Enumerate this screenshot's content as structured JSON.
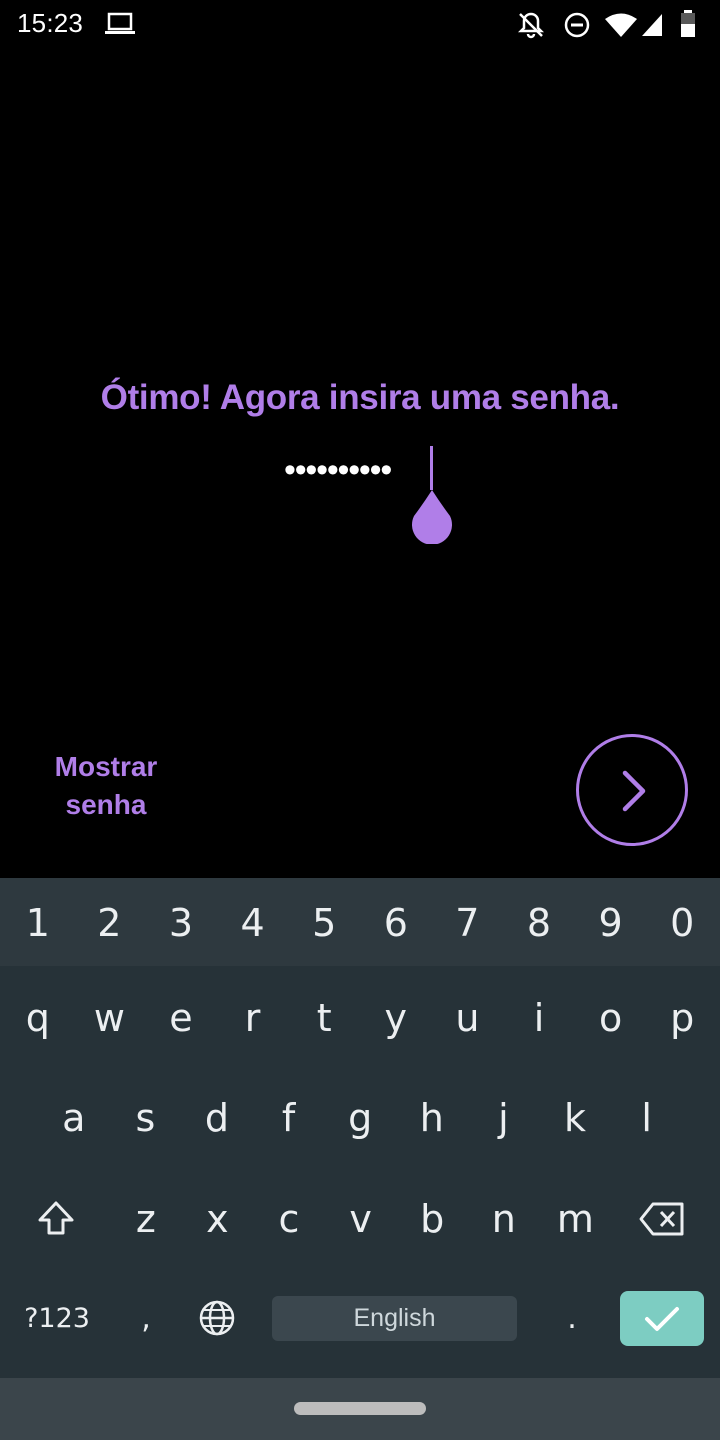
{
  "status_bar": {
    "time": "15:23",
    "icons": [
      "laptop-icon",
      "bell-off-icon",
      "dnd-icon",
      "wifi-icon",
      "signal-icon",
      "battery-icon"
    ]
  },
  "main": {
    "prompt": "Ótimo! Agora insira uma senha.",
    "password_masked": "••••••••••",
    "show_password_label": "Mostrar senha",
    "next_icon": "chevron-right-icon"
  },
  "keyboard": {
    "number_row": [
      "1",
      "2",
      "3",
      "4",
      "5",
      "6",
      "7",
      "8",
      "9",
      "0"
    ],
    "row1": [
      "q",
      "w",
      "e",
      "r",
      "t",
      "y",
      "u",
      "i",
      "o",
      "p"
    ],
    "row2": [
      "a",
      "s",
      "d",
      "f",
      "g",
      "h",
      "j",
      "k",
      "l"
    ],
    "row3": [
      "z",
      "x",
      "c",
      "v",
      "b",
      "n",
      "m"
    ],
    "symbols_label": "?123",
    "comma_label": ",",
    "period_label": ".",
    "space_label": "English",
    "shift_icon": "shift-icon",
    "backspace_icon": "backspace-icon",
    "globe_icon": "globe-icon",
    "enter_icon": "check-icon"
  },
  "colors": {
    "accent": "#b07ee8",
    "keyboard_bg": "#263238",
    "enter_key": "#7dcdc2"
  }
}
